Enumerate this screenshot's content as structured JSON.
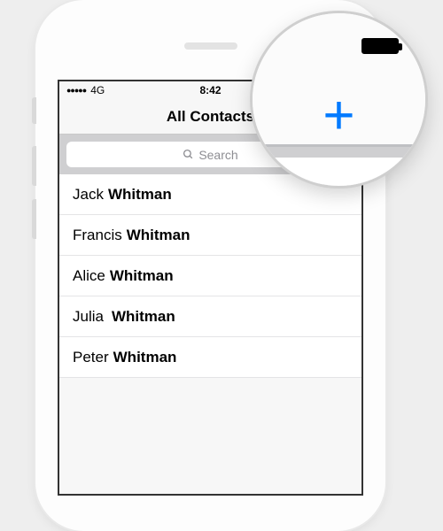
{
  "status": {
    "signal": "●●●●●",
    "carrier": "4G",
    "time": "8:42"
  },
  "nav": {
    "title": "All Contacts",
    "add_label": "+"
  },
  "search": {
    "placeholder": "Search"
  },
  "contacts": [
    {
      "first": "Jack",
      "last": "Whitman"
    },
    {
      "first": "Francis",
      "last": "Whitman"
    },
    {
      "first": "Alice",
      "last": "Whitman"
    },
    {
      "first": "Julia",
      "last": "Whitman"
    },
    {
      "first": "Peter",
      "last": "Whitman"
    }
  ],
  "lens": {
    "add_label": "+"
  }
}
